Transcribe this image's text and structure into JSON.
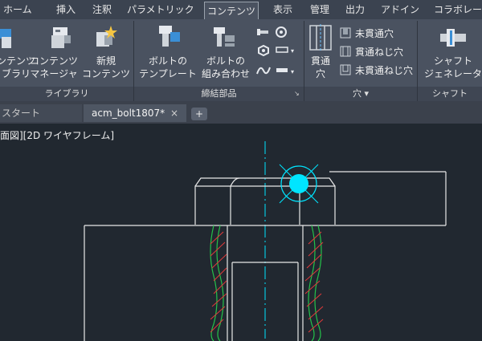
{
  "menu_tabs": [
    "ホーム",
    "挿入",
    "注釈",
    "パラメトリック",
    "コンテンツ",
    "表示",
    "管理",
    "出力",
    "アドイン",
    "コラボレー"
  ],
  "library_group": {
    "btn_library_l1": "ンテンツ",
    "btn_library_l2": "ブラリ",
    "btn_manager_l1": "コンテンツ",
    "btn_manager_l2": "マネージャ",
    "btn_new_l1": "新規",
    "btn_new_l2": "コンテンツ",
    "title": "ライブラリ"
  },
  "fastener_group": {
    "btn_bolt_template_l1": "ボルトの",
    "btn_bolt_template_l2": "テンプレート",
    "btn_bolt_combo_l1": "ボルトの",
    "btn_bolt_combo_l2": "組み合わせ",
    "title": "締結部品"
  },
  "hole_group": {
    "btn_through_l1": "貫通",
    "btn_through_l2": "穴",
    "blind_hole": "未貫通穴",
    "through_tapped": "貫通ねじ穴",
    "blind_tapped": "未貫通ねじ穴",
    "title": "穴"
  },
  "shaft_group": {
    "btn_shaft_l1": "シャフト",
    "btn_shaft_l2": "ジェネレータ",
    "title": "シャフト"
  },
  "doc_tabs": {
    "start": "スタート",
    "active": "acm_bolt1807*",
    "close": "×",
    "add": "+"
  },
  "viewport": {
    "label": "面図][2D ワイヤフレーム]"
  }
}
